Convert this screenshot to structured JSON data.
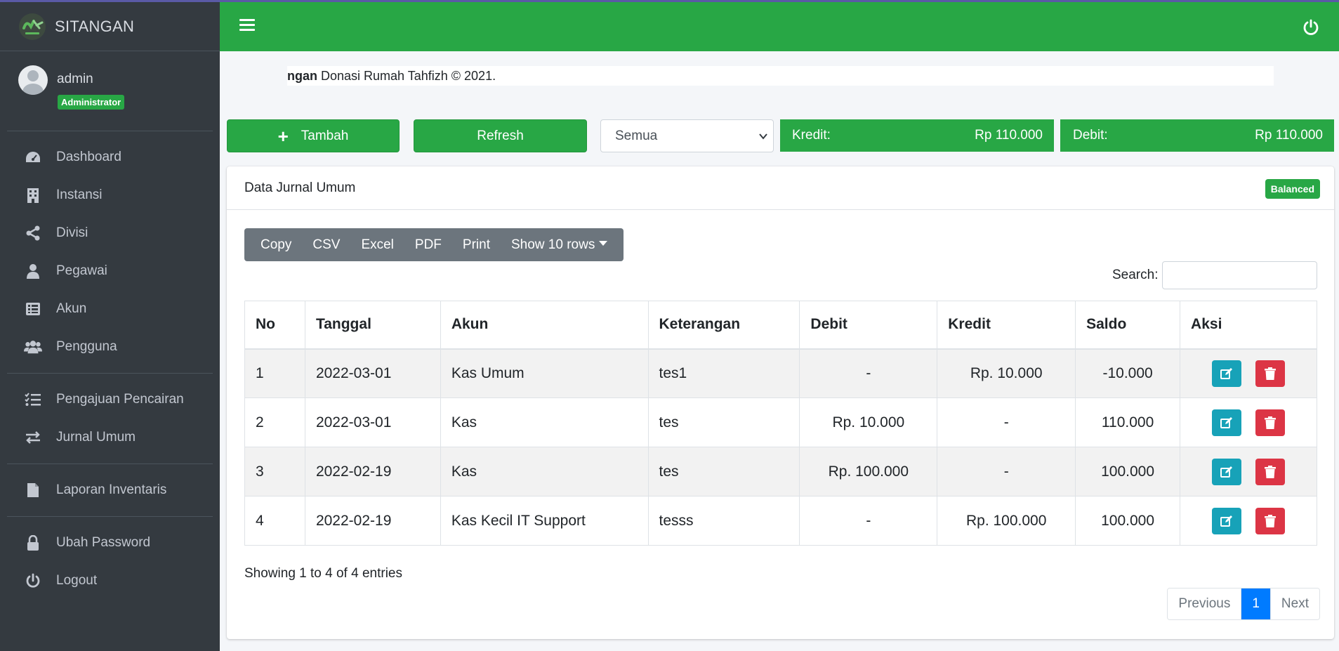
{
  "brand": {
    "name": "SITANGAN"
  },
  "user": {
    "name": "admin",
    "role": "Administrator"
  },
  "nav": {
    "group1": [
      {
        "label": "Dashboard",
        "icon": "dashboard-icon"
      },
      {
        "label": "Instansi",
        "icon": "building-icon"
      },
      {
        "label": "Divisi",
        "icon": "share-icon"
      },
      {
        "label": "Pegawai",
        "icon": "user-icon"
      },
      {
        "label": "Akun",
        "icon": "list-icon"
      },
      {
        "label": "Pengguna",
        "icon": "users-icon"
      }
    ],
    "group2": [
      {
        "label": "Pengajuan Pencairan",
        "icon": "tasks-icon"
      },
      {
        "label": "Jurnal Umum",
        "icon": "exchange-icon"
      }
    ],
    "group3": [
      {
        "label": "Laporan Inventaris",
        "icon": "file-icon"
      }
    ],
    "group4": [
      {
        "label": "Ubah Password",
        "icon": "lock-icon"
      },
      {
        "label": "Logout",
        "icon": "power-icon"
      }
    ]
  },
  "marquee": {
    "bold": "ngan",
    "text": " Donasi Rumah Tahfizh © 2021."
  },
  "toolbar": {
    "tambah": "Tambah",
    "refresh": "Refresh",
    "filter_value": "Semua",
    "kredit_label": "Kredit:",
    "kredit_value": "Rp 110.000",
    "debit_label": "Debit:",
    "debit_value": "Rp 110.000"
  },
  "card": {
    "title": "Data Jurnal Umum",
    "badge": "Balanced"
  },
  "dt_buttons": {
    "copy": "Copy",
    "csv": "CSV",
    "excel": "Excel",
    "pdf": "PDF",
    "print": "Print",
    "show": "Show 10 rows"
  },
  "search": {
    "label": "Search:",
    "value": ""
  },
  "table": {
    "headers": {
      "no": "No",
      "tanggal": "Tanggal",
      "akun": "Akun",
      "keterangan": "Keterangan",
      "debit": "Debit",
      "kredit": "Kredit",
      "saldo": "Saldo",
      "aksi": "Aksi"
    },
    "rows": [
      {
        "no": "1",
        "tanggal": "2022-03-01",
        "akun": "Kas Umum",
        "keterangan": "tes1",
        "debit": "-",
        "kredit": "Rp. 10.000",
        "saldo": "-10.000"
      },
      {
        "no": "2",
        "tanggal": "2022-03-01",
        "akun": "Kas",
        "keterangan": "tes",
        "debit": "Rp. 10.000",
        "kredit": "-",
        "saldo": "110.000"
      },
      {
        "no": "3",
        "tanggal": "2022-02-19",
        "akun": "Kas",
        "keterangan": "tes",
        "debit": "Rp. 100.000",
        "kredit": "-",
        "saldo": "100.000"
      },
      {
        "no": "4",
        "tanggal": "2022-02-19",
        "akun": "Kas Kecil IT Support",
        "keterangan": "tesss",
        "debit": "-",
        "kredit": "Rp. 100.000",
        "saldo": "100.000"
      }
    ]
  },
  "footer": {
    "info": "Showing 1 to 4 of 4 entries",
    "previous": "Previous",
    "page": "1",
    "next": "Next"
  },
  "colors": {
    "primary_green": "#28a745",
    "sidebar": "#343a40",
    "info": "#17a2b8",
    "danger": "#dc3545",
    "page_active": "#007bff"
  }
}
